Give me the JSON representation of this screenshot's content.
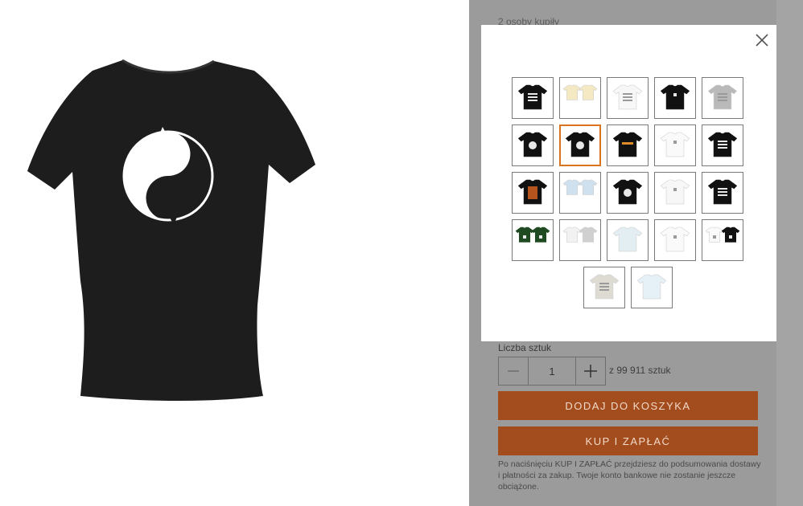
{
  "product": {
    "image_alt": "Czarna damska koszulka z motywem yin-yang kotów",
    "shirt_color": "#1d1d1d",
    "print_color": "#ffffff"
  },
  "panel": {
    "buyers_text": "2 osoby kupiły",
    "quantity_label": "Liczba sztuk",
    "quantity_value": "1",
    "stock_text": "z 99 911 sztuk",
    "add_to_cart": "DODAJ DO KOSZYKA",
    "buy_now": "KUP I ZAPŁAĆ",
    "disclaimer": "Po naciśnięciu KUP I ZAPŁAĆ przejdziesz do podsumowania dostawy i płatności za zakup. Twoje konto bankowe nie zostanie jeszcze obciążone.",
    "accent_color": "#a34c1d"
  },
  "modal": {
    "close_icon": "close-icon",
    "selected_index": 6,
    "thumbnails": [
      {
        "name": "variant-black-print",
        "colors": [
          "#111111"
        ],
        "print": "text"
      },
      {
        "name": "variant-cream-pair",
        "colors": [
          "#f5e9c4",
          "#f5e9c4"
        ],
        "print": "none"
      },
      {
        "name": "variant-white-print",
        "colors": [
          "#f7f7f7"
        ],
        "print": "text"
      },
      {
        "name": "variant-black-small-print",
        "colors": [
          "#111111"
        ],
        "print": "small"
      },
      {
        "name": "variant-gray-print",
        "colors": [
          "#b9b9b9"
        ],
        "print": "text"
      },
      {
        "name": "variant-black-round-print",
        "colors": [
          "#111111"
        ],
        "print": "circle"
      },
      {
        "name": "variant-black-yinyang",
        "colors": [
          "#111111"
        ],
        "print": "circle"
      },
      {
        "name": "variant-black-orange-print",
        "colors": [
          "#111111"
        ],
        "print": "orange"
      },
      {
        "name": "variant-white-plain",
        "colors": [
          "#fafafa"
        ],
        "print": "small"
      },
      {
        "name": "variant-black-text-print",
        "colors": [
          "#111111"
        ],
        "print": "text"
      },
      {
        "name": "variant-black-photo-print",
        "colors": [
          "#111111"
        ],
        "print": "photo"
      },
      {
        "name": "variant-lightblue-pair",
        "colors": [
          "#cfe0ef",
          "#cfe0ef"
        ],
        "print": "none"
      },
      {
        "name": "variant-black-emblem",
        "colors": [
          "#111111"
        ],
        "print": "circle"
      },
      {
        "name": "variant-white-emblem",
        "colors": [
          "#f7f7f7"
        ],
        "print": "small"
      },
      {
        "name": "variant-black-text-print-2",
        "colors": [
          "#111111"
        ],
        "print": "text"
      },
      {
        "name": "variant-green-pair",
        "colors": [
          "#1f4a22",
          "#1f4a22"
        ],
        "print": "small"
      },
      {
        "name": "variant-white-gray-pair",
        "colors": [
          "#f2f2f2",
          "#d0d0d0"
        ],
        "print": "none"
      },
      {
        "name": "variant-lightblue-shirt",
        "colors": [
          "#e3eef3"
        ],
        "print": "none"
      },
      {
        "name": "variant-white-shirt",
        "colors": [
          "#fafafa"
        ],
        "print": "small"
      },
      {
        "name": "variant-white-black-pair",
        "colors": [
          "#fafafa",
          "#111111"
        ],
        "print": "small"
      },
      {
        "name": "variant-beige-print",
        "colors": [
          "#dedbd3"
        ],
        "print": "text"
      },
      {
        "name": "variant-lightblue-shirt-2",
        "colors": [
          "#e6f1f7"
        ],
        "print": "none"
      }
    ]
  }
}
